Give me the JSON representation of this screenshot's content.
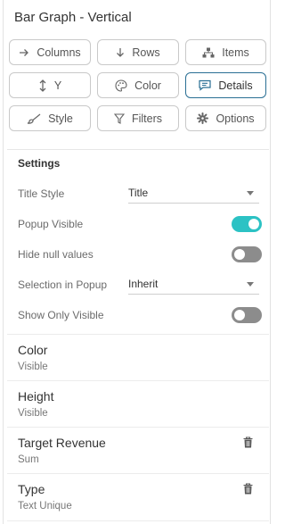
{
  "header": {
    "title": "Bar Graph - Vertical"
  },
  "buttons": [
    {
      "label": "Columns",
      "icon": "arrow-right-icon",
      "active": false
    },
    {
      "label": "Rows",
      "icon": "arrow-down-icon",
      "active": false
    },
    {
      "label": "Items",
      "icon": "hierarchy-icon",
      "active": false
    },
    {
      "label": "Y",
      "icon": "vertical-arrows-icon",
      "active": false
    },
    {
      "label": "Color",
      "icon": "palette-icon",
      "active": false
    },
    {
      "label": "Details",
      "icon": "comment-icon",
      "active": true
    },
    {
      "label": "Style",
      "icon": "brush-icon",
      "active": false
    },
    {
      "label": "Filters",
      "icon": "filter-icon",
      "active": false
    },
    {
      "label": "Options",
      "icon": "gear-icon",
      "active": false
    }
  ],
  "settings": {
    "heading": "Settings",
    "title_style": {
      "label": "Title Style",
      "value": "Title"
    },
    "popup_visible": {
      "label": "Popup Visible",
      "on": true
    },
    "hide_null": {
      "label": "Hide null values",
      "on": false
    },
    "selection_in_popup": {
      "label": "Selection in Popup",
      "value": "Inherit"
    },
    "show_only_visible": {
      "label": "Show Only Visible",
      "on": false
    }
  },
  "items": [
    {
      "name": "Color",
      "sub": "Visible",
      "deletable": false
    },
    {
      "name": "Height",
      "sub": "Visible",
      "deletable": false
    },
    {
      "name": "Target Revenue",
      "sub": "Sum",
      "deletable": true
    },
    {
      "name": "Type",
      "sub": "Text Unique",
      "deletable": true
    }
  ],
  "colors": {
    "accent": "#2cc2c4",
    "active_border": "#2a6f94",
    "toggle_off": "#8c8c8c"
  }
}
